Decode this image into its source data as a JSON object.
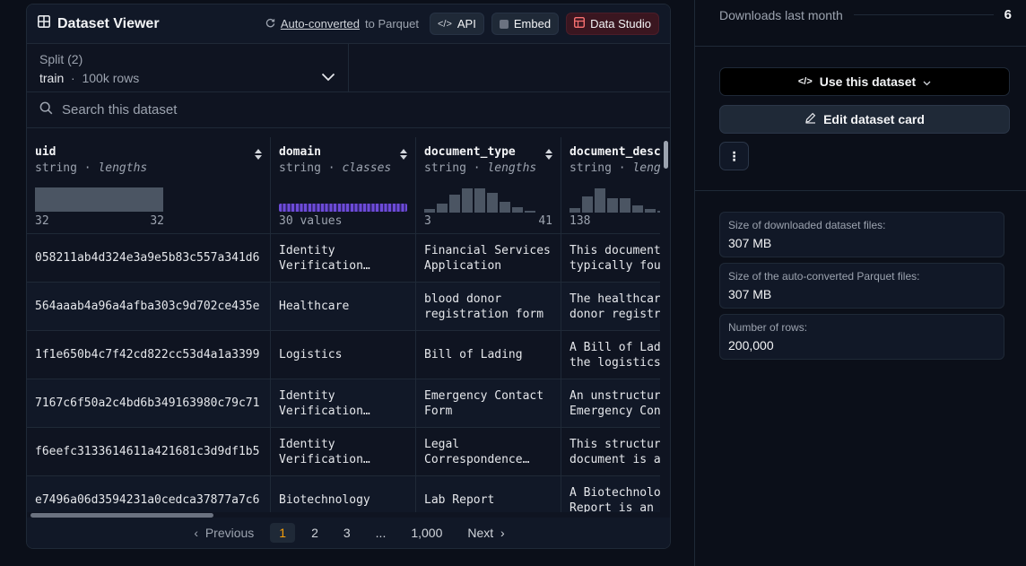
{
  "viewer": {
    "title": "Dataset Viewer",
    "auto_converted_link": "Auto-converted",
    "auto_converted_suffix": "to Parquet",
    "api_label": "API",
    "embed_label": "Embed",
    "data_studio_label": "Data Studio"
  },
  "split": {
    "label": "Split (2)",
    "name": "train",
    "separator": "·",
    "rows": "100k rows"
  },
  "search": {
    "placeholder": "Search this dataset"
  },
  "columns": [
    {
      "name": "uid",
      "type": "string",
      "stat": "lengths",
      "min": "32",
      "max": "32"
    },
    {
      "name": "domain",
      "type": "string",
      "stat": "classes",
      "summary": "30 values"
    },
    {
      "name": "document_type",
      "type": "string",
      "stat": "lengths",
      "min": "3",
      "max": "41"
    },
    {
      "name": "document_desc",
      "type": "string",
      "stat": "lengths",
      "min": "138",
      "max": ""
    }
  ],
  "rows": [
    [
      "058211ab4d324e3a9e5b83c557a341d6",
      "Identity\nVerification…",
      "Financial Services\nApplication",
      "This document\ntypically fou"
    ],
    [
      "564aaab4a96a4afba303c9d702ce435e",
      "Healthcare",
      "blood donor\nregistration form",
      "The healthcar\ndonor registr"
    ],
    [
      "1f1e650b4c7f42cd822cc53d4a1a3399",
      "Logistics",
      "Bill of Lading",
      "A Bill of Lad\nthe logistics"
    ],
    [
      "7167c6f50a2c4bd6b349163980c79c71",
      "Identity\nVerification…",
      "Emergency Contact\nForm",
      "An unstructur\nEmergency Con"
    ],
    [
      "f6eefc3133614611a421681c3d9df1b5",
      "Identity\nVerification…",
      "Legal\nCorrespondence…",
      "This structur\ndocument is a"
    ],
    [
      "e7496a06d3594231a0cedca37877a7c6",
      "Biotechnology",
      "Lab Report",
      "A Biotechnolo\nReport is an"
    ]
  ],
  "pagination": {
    "previous": "Previous",
    "pages": [
      "1",
      "2",
      "3",
      "...",
      "1,000"
    ],
    "active": "1",
    "next": "Next"
  },
  "sidebar": {
    "downloads_label": "Downloads last month",
    "downloads_value": "6",
    "use_dataset_label": "Use this dataset",
    "edit_card_label": "Edit dataset card",
    "more_label": "⋮",
    "info": [
      {
        "label": "Size of downloaded dataset files:",
        "value": "307 MB"
      },
      {
        "label": "Size of the auto-converted Parquet files:",
        "value": "307 MB"
      },
      {
        "label": "Number of rows:",
        "value": "200,000"
      }
    ]
  }
}
